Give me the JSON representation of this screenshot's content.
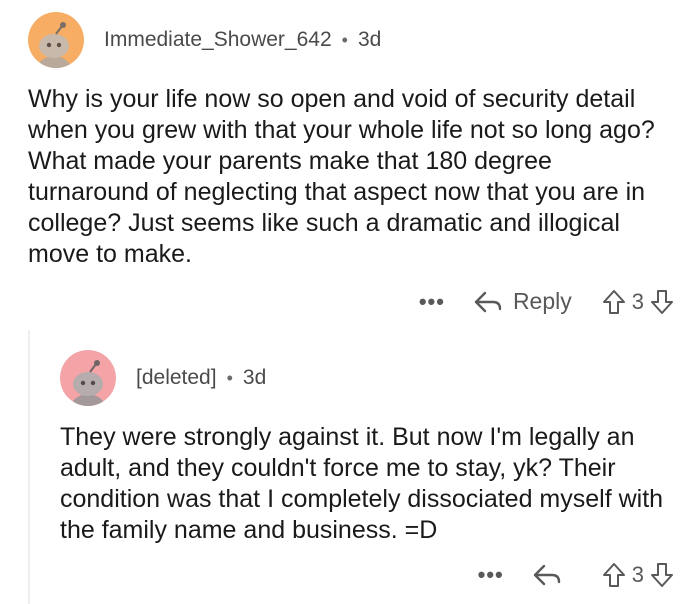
{
  "top_comment": {
    "username": "Immediate_Shower_642",
    "separator": "•",
    "age": "3d",
    "body": "Why is your life now so open and void of security detail when you grew with that your whole life not so long ago? What made your parents make that 180 degree turnaround of neglecting that aspect now that you are in college? Just seems like such a dramatic and illogical move to make.",
    "more_label": "•••",
    "reply_label": "Reply",
    "score": "3",
    "avatar_color": "#f7ad63"
  },
  "reply_comment": {
    "username": "[deleted]",
    "separator": "•",
    "age": "3d",
    "body": "They were strongly against it. But now I'm legally an adult, and they couldn't force me to stay, yk? Their condition was that I completely dissociated myself with the family name and business. =D",
    "more_label": "•••",
    "score": "3",
    "avatar_color": "#f4a3a7"
  }
}
